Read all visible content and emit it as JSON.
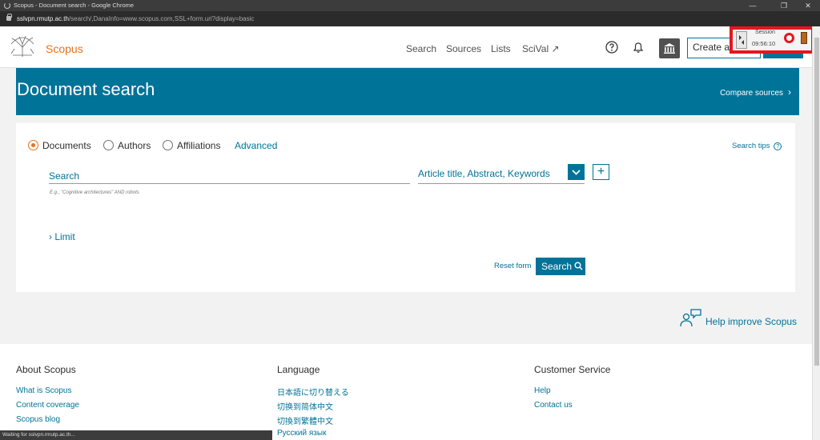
{
  "browser": {
    "title": "Scopus - Document search - Google Chrome",
    "url_host": "sslvpn.rmutp.ac.th",
    "url_path": "/search/,DanaInfo=www.scopus.com,SSL+form.uri?display=basic",
    "status": "Waiting for sslvpn.rmutp.ac.th..."
  },
  "header": {
    "brand": "Scopus",
    "nav": [
      "Search",
      "Sources",
      "Lists",
      "SciVal ↗"
    ],
    "create_account": "Create account",
    "accent": "#007398",
    "brand_color": "#e9711c"
  },
  "session": {
    "label": "Session",
    "time": "09:56:10"
  },
  "hero": {
    "title": "Document search",
    "compare": "Compare sources"
  },
  "search": {
    "options": [
      "Documents",
      "Authors",
      "Affiliations"
    ],
    "selected": "Documents",
    "advanced": "Advanced",
    "tips": "Search tips",
    "placeholder": "Search",
    "hint": "E.g., \"Cognitive architectures\" AND robots",
    "field": "Article title, Abstract, Keywords",
    "limit": "Limit",
    "reset": "Reset form",
    "submit": "Search"
  },
  "help_improve": "Help improve Scopus",
  "footer": {
    "about": {
      "heading": "About Scopus",
      "links": [
        "What is Scopus",
        "Content coverage",
        "Scopus blog"
      ]
    },
    "language": {
      "heading": "Language",
      "links": [
        "日本語に切り替える",
        "切换到简体中文",
        "切換到繁體中文",
        "Русский язык"
      ]
    },
    "service": {
      "heading": "Customer Service",
      "links": [
        "Help",
        "Contact us"
      ]
    }
  }
}
